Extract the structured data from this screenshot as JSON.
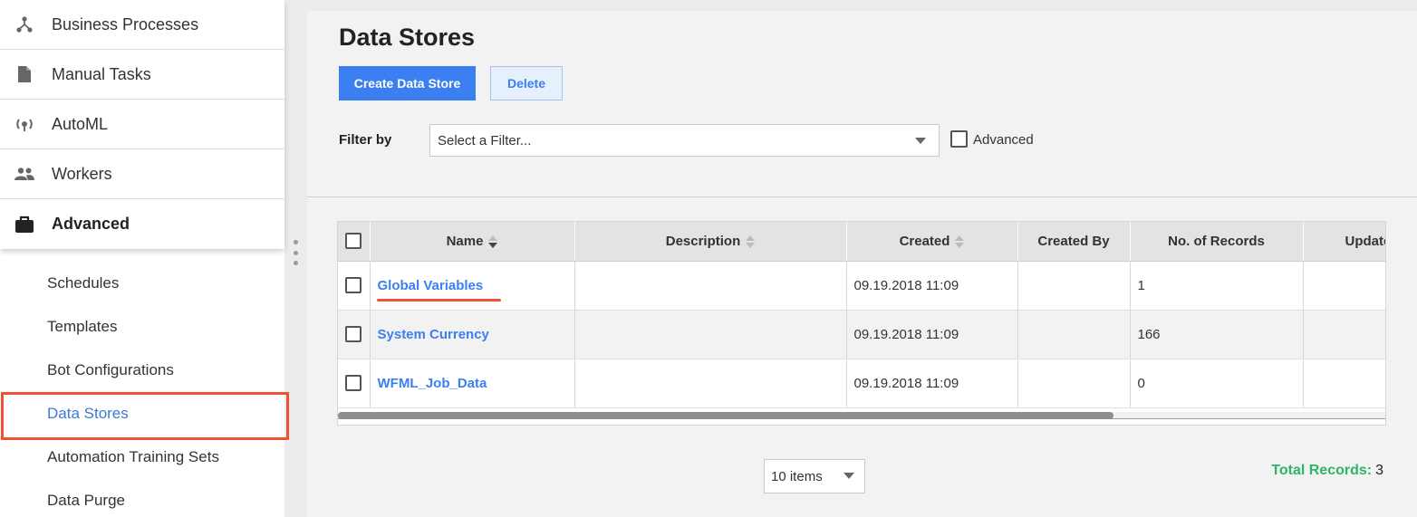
{
  "sidebar": {
    "nav": [
      {
        "label": "Business Processes",
        "icon": "hierarchy-icon"
      },
      {
        "label": "Manual Tasks",
        "icon": "document-icon"
      },
      {
        "label": "AutoML",
        "icon": "automl-icon"
      },
      {
        "label": "Workers",
        "icon": "people-icon"
      },
      {
        "label": "Advanced",
        "icon": "briefcase-icon"
      }
    ],
    "sub_items": [
      "Schedules",
      "Templates",
      "Bot Configurations",
      "Data Stores",
      "Automation Training Sets",
      "Data Purge"
    ],
    "active_sub_item": "Data Stores"
  },
  "main": {
    "title": "Data Stores",
    "create_label": "Create Data Store",
    "delete_label": "Delete",
    "filter_label": "Filter by",
    "filter_placeholder": "Select a Filter...",
    "advanced_label": "Advanced"
  },
  "grid": {
    "columns": [
      "Name",
      "Description",
      "Created",
      "Created By",
      "No. of Records",
      "Updated"
    ],
    "rows": [
      {
        "name": "Global Variables",
        "description": "",
        "created": "09.19.2018 11:09",
        "created_by": "",
        "records": "1"
      },
      {
        "name": "System Currency",
        "description": "",
        "created": "09.19.2018 11:09",
        "created_by": "",
        "records": "166"
      },
      {
        "name": "WFML_Job_Data",
        "description": "",
        "created": "09.19.2018 11:09",
        "created_by": "",
        "records": "0"
      }
    ]
  },
  "footer": {
    "page_size": "10 items",
    "total_label": "Total Records:",
    "total_value": "3"
  },
  "colors": {
    "accent": "#3b7ff0",
    "highlight": "#ef5134",
    "total": "#2fb36b"
  }
}
